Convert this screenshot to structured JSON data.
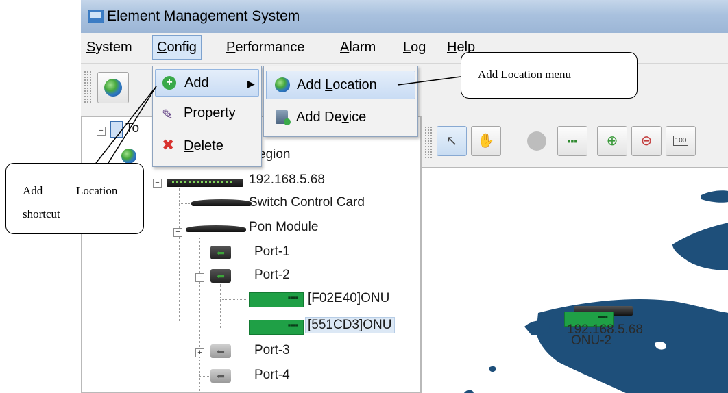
{
  "window": {
    "title": "Element Management System"
  },
  "menubar": [
    {
      "pre": "",
      "key": "S",
      "post": "ystem"
    },
    {
      "pre": "",
      "key": "C",
      "post": "onfig"
    },
    {
      "pre": "",
      "key": "P",
      "post": "erformance"
    },
    {
      "pre": "",
      "key": "A",
      "post": "larm"
    },
    {
      "pre": "",
      "key": "L",
      "post": "og"
    },
    {
      "pre": "",
      "key": "H",
      "post": "elp"
    }
  ],
  "config_menu": {
    "add": "Add",
    "property": "Property",
    "delete_key": "D",
    "delete_rest": "elete"
  },
  "add_submenu": {
    "location_pre": "Add ",
    "location_key": "L",
    "location_post": "ocation",
    "device_pre": "Add De",
    "device_key": "v",
    "device_post": "ice"
  },
  "tree": {
    "root_partial": "To",
    "region_partial": "egion",
    "device": "192.168.5.68",
    "switch_card": "Switch Control Card",
    "pon_module": "Pon Module",
    "port1": "Port-1",
    "port2": "Port-2",
    "onu1": "[F02E40]ONU",
    "onu2": "[551CD3]ONU",
    "port3": "Port-3",
    "port4": "Port-4"
  },
  "map": {
    "device_label": "192.168.5.68",
    "onu_label": "ONU-2",
    "zoom_label": "100"
  },
  "callouts": {
    "menu": "Add Location menu",
    "shortcut_line1_a": "Add",
    "shortcut_line1_b": "Location",
    "shortcut_line2": "shortcut"
  },
  "colors": {
    "titlebar": "#a9c1de",
    "selection": "#dce8f5",
    "onu_green": "#1fa046"
  }
}
